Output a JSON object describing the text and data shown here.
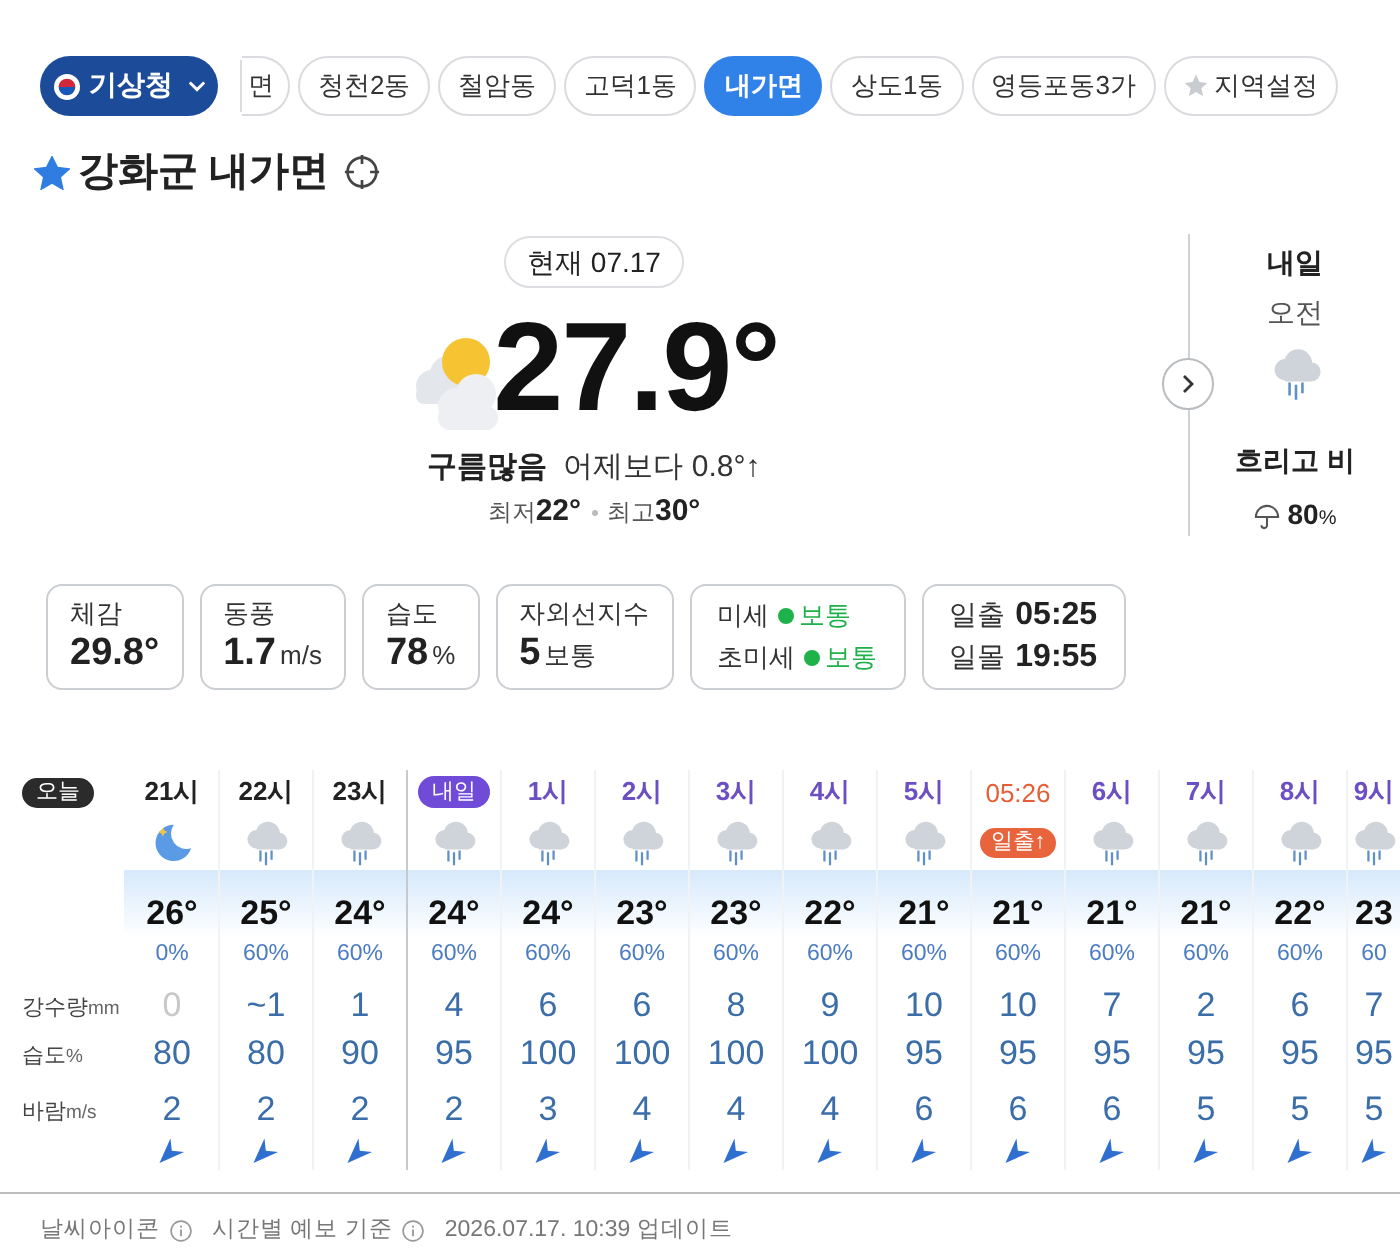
{
  "source_button": {
    "label": "기상청"
  },
  "region_tabs": [
    {
      "label": "면",
      "kind": "clipped",
      "selected": false
    },
    {
      "label": "청천2동",
      "kind": "region",
      "selected": false
    },
    {
      "label": "철암동",
      "kind": "region",
      "selected": false
    },
    {
      "label": "고덕1동",
      "kind": "region",
      "selected": false
    },
    {
      "label": "내가면",
      "kind": "region",
      "selected": true
    },
    {
      "label": "상도1동",
      "kind": "region",
      "selected": false
    },
    {
      "label": "영등포동3가",
      "kind": "region",
      "selected": false
    },
    {
      "label": "지역설정",
      "kind": "settings",
      "selected": false
    }
  ],
  "location": {
    "title": "강화군 내가면",
    "favorite": true
  },
  "current": {
    "date_badge": "현재 07.17",
    "temperature": "27.9°",
    "condition": "구름많음",
    "comparison": "어제보다 0.8°↑",
    "low_label": "최저",
    "low": "22°",
    "high_label": "최고",
    "high": "30°"
  },
  "tomorrow": {
    "title": "내일",
    "period": "오전",
    "condition": "흐리고 비",
    "rain_chance": "80",
    "rain_chance_unit": "%"
  },
  "details": [
    {
      "kind": "metric",
      "label": "체감",
      "value": "29.8°"
    },
    {
      "kind": "metric",
      "label": "동풍",
      "value": "1.7",
      "unit": "m/s"
    },
    {
      "kind": "metric",
      "label": "습도",
      "value": "78",
      "unit": "%"
    },
    {
      "kind": "metric",
      "label": "자외선지수",
      "value": "5",
      "unit": "보통"
    },
    {
      "kind": "air",
      "rows": [
        {
          "label": "미세",
          "status": "보통",
          "color": "#1fb14a"
        },
        {
          "label": "초미세",
          "status": "보통",
          "color": "#1fb14a"
        }
      ]
    },
    {
      "kind": "sun",
      "rows": [
        {
          "label": "일출",
          "time": "05:25"
        },
        {
          "label": "일몰",
          "time": "19:55"
        }
      ]
    }
  ],
  "hourly": {
    "today_badge": "오늘",
    "row_labels": [
      {
        "name": "강수량",
        "unit": "mm"
      },
      {
        "name": "습도",
        "unit": "%"
      },
      {
        "name": "바람",
        "unit": "m/s"
      }
    ],
    "hours": [
      {
        "kind": "night",
        "label": "21시",
        "color": "#222222",
        "temp": "26°",
        "chance": "0%",
        "precip": "0",
        "precip_dim": true,
        "humidity": "80",
        "wind": "2"
      },
      {
        "kind": "rain",
        "label": "22시",
        "color": "#222222",
        "temp": "25°",
        "chance": "60%",
        "precip": "~1",
        "precip_dim": false,
        "humidity": "80",
        "wind": "2"
      },
      {
        "kind": "rain",
        "label": "23시",
        "color": "#222222",
        "temp": "24°",
        "chance": "60%",
        "precip": "1",
        "precip_dim": false,
        "humidity": "90",
        "wind": "2"
      },
      {
        "kind": "new_day",
        "label": "내일",
        "color": "#6f4bd8",
        "temp": "24°",
        "chance": "60%",
        "precip": "4",
        "precip_dim": false,
        "humidity": "95",
        "wind": "2"
      },
      {
        "kind": "rain",
        "label": "1시",
        "color": "#6b4fc3",
        "temp": "24°",
        "chance": "60%",
        "precip": "6",
        "precip_dim": false,
        "humidity": "100",
        "wind": "3"
      },
      {
        "kind": "rain",
        "label": "2시",
        "color": "#6b4fc3",
        "temp": "23°",
        "chance": "60%",
        "precip": "6",
        "precip_dim": false,
        "humidity": "100",
        "wind": "4"
      },
      {
        "kind": "rain",
        "label": "3시",
        "color": "#6b4fc3",
        "temp": "23°",
        "chance": "60%",
        "precip": "8",
        "precip_dim": false,
        "humidity": "100",
        "wind": "4"
      },
      {
        "kind": "rain",
        "label": "4시",
        "color": "#6b4fc3",
        "temp": "22°",
        "chance": "60%",
        "precip": "9",
        "precip_dim": false,
        "humidity": "100",
        "wind": "4"
      },
      {
        "kind": "rain",
        "label": "5시",
        "color": "#6b4fc3",
        "temp": "21°",
        "chance": "60%",
        "precip": "10",
        "precip_dim": false,
        "humidity": "95",
        "wind": "6"
      },
      {
        "kind": "sunrise",
        "label": "05:26",
        "color": "#e55f36",
        "badge": "일출↑",
        "temp": "21°",
        "chance": "60%",
        "precip": "10",
        "precip_dim": false,
        "humidity": "95",
        "wind": "6"
      },
      {
        "kind": "rain",
        "label": "6시",
        "color": "#6b4fc3",
        "temp": "21°",
        "chance": "60%",
        "precip": "7",
        "precip_dim": false,
        "humidity": "95",
        "wind": "6"
      },
      {
        "kind": "rain",
        "label": "7시",
        "color": "#6b4fc3",
        "temp": "21°",
        "chance": "60%",
        "precip": "2",
        "precip_dim": false,
        "humidity": "95",
        "wind": "5"
      },
      {
        "kind": "rain",
        "label": "8시",
        "color": "#6b4fc3",
        "temp": "22°",
        "chance": "60%",
        "precip": "6",
        "precip_dim": false,
        "humidity": "95",
        "wind": "5"
      },
      {
        "kind": "rain",
        "label": "9시",
        "color": "#6b4fc3",
        "temp": "23",
        "chance": "60",
        "precip": "7",
        "precip_dim": false,
        "humidity": "95",
        "wind": "5"
      }
    ]
  },
  "footer": {
    "items": [
      {
        "text": "날씨아이콘",
        "info": true
      },
      {
        "text": "시간별 예보 기준",
        "info": true
      },
      {
        "text": "2026.07.17. 10:39 업데이트",
        "info": false
      }
    ]
  }
}
